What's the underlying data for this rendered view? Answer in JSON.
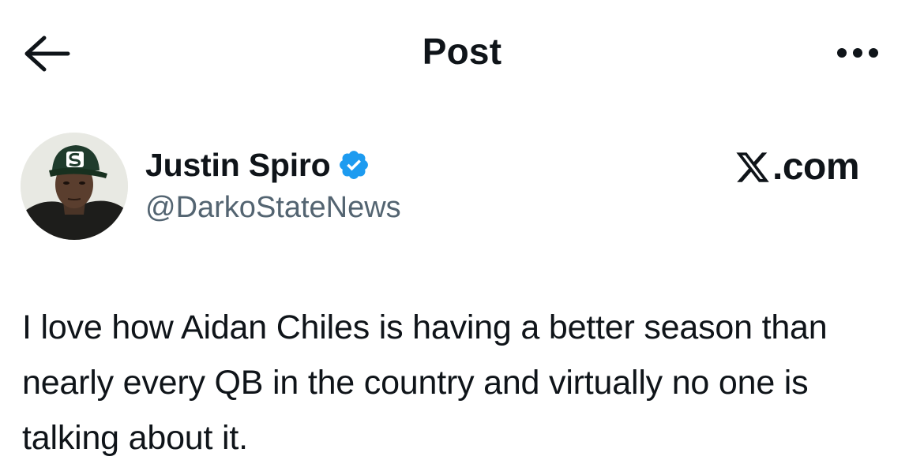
{
  "header": {
    "title": "Post",
    "back_icon": "arrow-left-icon",
    "more_icon": "ellipsis-icon"
  },
  "author": {
    "display_name": "Justin Spiro",
    "handle": "@DarkoStateNews",
    "verified": true,
    "verified_color": "#1d9bf0",
    "avatar_icon": "profile-photo"
  },
  "brand": {
    "logo_icon": "x-logo-icon",
    "domain": ".com"
  },
  "post": {
    "text": "I love how Aidan Chiles is having a better season than nearly every QB in the country and virtually no one is talking about it."
  },
  "colors": {
    "text_primary": "#0f1419",
    "text_secondary": "#536471",
    "background": "#ffffff"
  }
}
